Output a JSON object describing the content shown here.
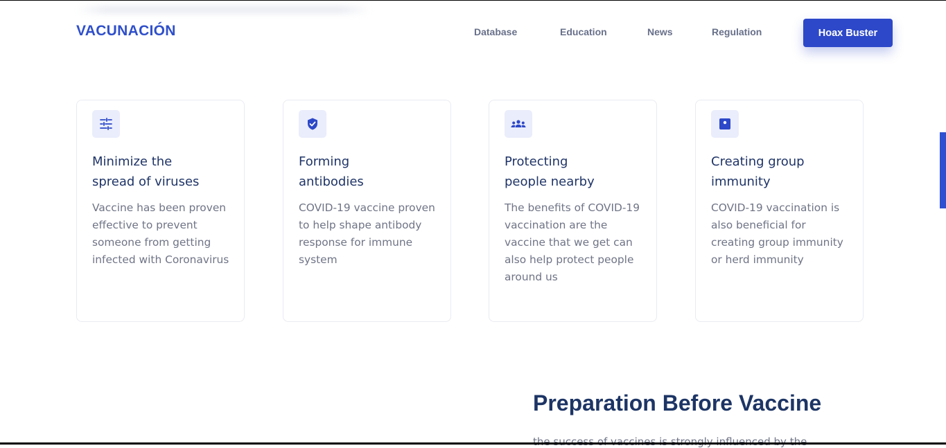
{
  "brand": "VACUNACIÓN",
  "nav": {
    "items": [
      {
        "label": "Database"
      },
      {
        "label": "Education"
      },
      {
        "label": "News"
      },
      {
        "label": "Regulation"
      }
    ],
    "cta_label": "Hoax Buster"
  },
  "features": [
    {
      "icon": "sliders-icon",
      "title_line1": "Minimize the",
      "title_line2": "spread of viruses",
      "body": "Vaccine has been proven effective to prevent someone from getting infected with Coronavirus"
    },
    {
      "icon": "shield-check-icon",
      "title_line1": "Forming",
      "title_line2": "antibodies",
      "body": "COVID-19 vaccine proven to help shape antibody response for immune system"
    },
    {
      "icon": "people-group-icon",
      "title_line1": "Protecting",
      "title_line2": "people nearby",
      "body": "The benefits of COVID-19 vaccination are the vaccine that we get can also help protect people around us"
    },
    {
      "icon": "badge-icon",
      "title_line1": "Creating group",
      "title_line2": "immunity",
      "body": "COVID-19 vaccination is also beneficial for creating group immunity or herd immunity"
    }
  ],
  "section": {
    "title": "Preparation Before Vaccine",
    "subtitle_partial": "the success of vaccines is strongly influenced by the"
  },
  "colors": {
    "accent": "#2D48C8",
    "heading": "#1D3565",
    "body_text": "#6F7486",
    "icon_bg": "#EAEDFB"
  }
}
